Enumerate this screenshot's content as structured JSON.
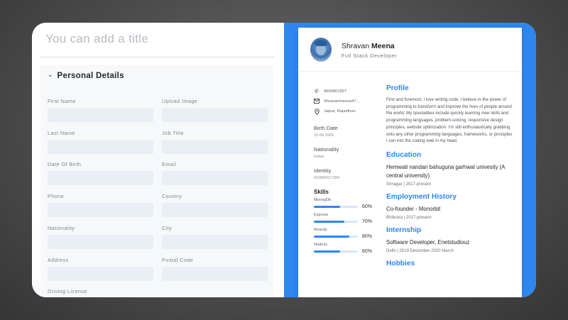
{
  "editor": {
    "title_placeholder": "You can add a title",
    "section_title": "Personal Details",
    "fields": [
      {
        "label": "First Name"
      },
      {
        "label": "Upload Image"
      },
      {
        "label": "Last Name"
      },
      {
        "label": "Job Title"
      },
      {
        "label": "Date Of Birth"
      },
      {
        "label": "Email"
      },
      {
        "label": "Phone"
      },
      {
        "label": "Country"
      },
      {
        "label": "Nationality"
      },
      {
        "label": "City"
      },
      {
        "label": "Address"
      },
      {
        "label": "Postal Code"
      },
      {
        "label": "Driving License"
      }
    ]
  },
  "resume": {
    "first_name": "Shravan",
    "last_name": "Meena",
    "role": "Full Stack Developer",
    "contacts": {
      "phone": "9660801827",
      "email": "Shravanmeena47...",
      "location": "Jaipur, Rajasthan"
    },
    "birth_label": "Birth Date",
    "birth_value": "15-06-1999",
    "nationality_label": "Nationality",
    "nationality_value": "Indian",
    "identity_label": "Identity",
    "identity_value": "816850017284",
    "skills_title": "Skills",
    "skills": [
      {
        "name": "MonogDb",
        "percent": 60,
        "label": "60%"
      },
      {
        "name": "Express",
        "percent": 70,
        "label": "70%"
      },
      {
        "name": "Reactjs",
        "percent": 80,
        "label": "80%"
      },
      {
        "name": "NodeJs",
        "percent": 60,
        "label": "60%"
      }
    ],
    "profile_title": "Profile",
    "profile_text": "First and foremost, I love writing code. I believe in the power of programming to transform and improve the lives of people around the world. My specialities include quickly learning new skills and programming languages, problem-solving, responsive design principles, website optimization. I'm still enthusiastically grabbing onto any other programming languages, frameworks, or principles I can into the coding web in my head.",
    "education_title": "Education",
    "education_school": "Hemwati nandan bahuguna garhwal univesity (A central university)",
    "education_sub": "Srinagar | 2017-present",
    "employment_title": "Employment History",
    "employment_role": "Co-founder - Monorbit",
    "employment_sub": "Bhilwara | 2017-present",
    "internship_title": "Internship",
    "internship_role": "Software Developer, Enetstudiouz",
    "internship_sub": "Delhi | 2019 December-2020 March",
    "hobbies_title": "Hobbies"
  },
  "colors": {
    "accent": "#2e86f0",
    "field_bg": "#eaeef5",
    "section_bg": "#f7f8fa"
  },
  "icons": {
    "chevron": "chevron-down-icon",
    "phone": "phone-icon",
    "email": "mail-icon",
    "location": "location-pin-icon"
  }
}
